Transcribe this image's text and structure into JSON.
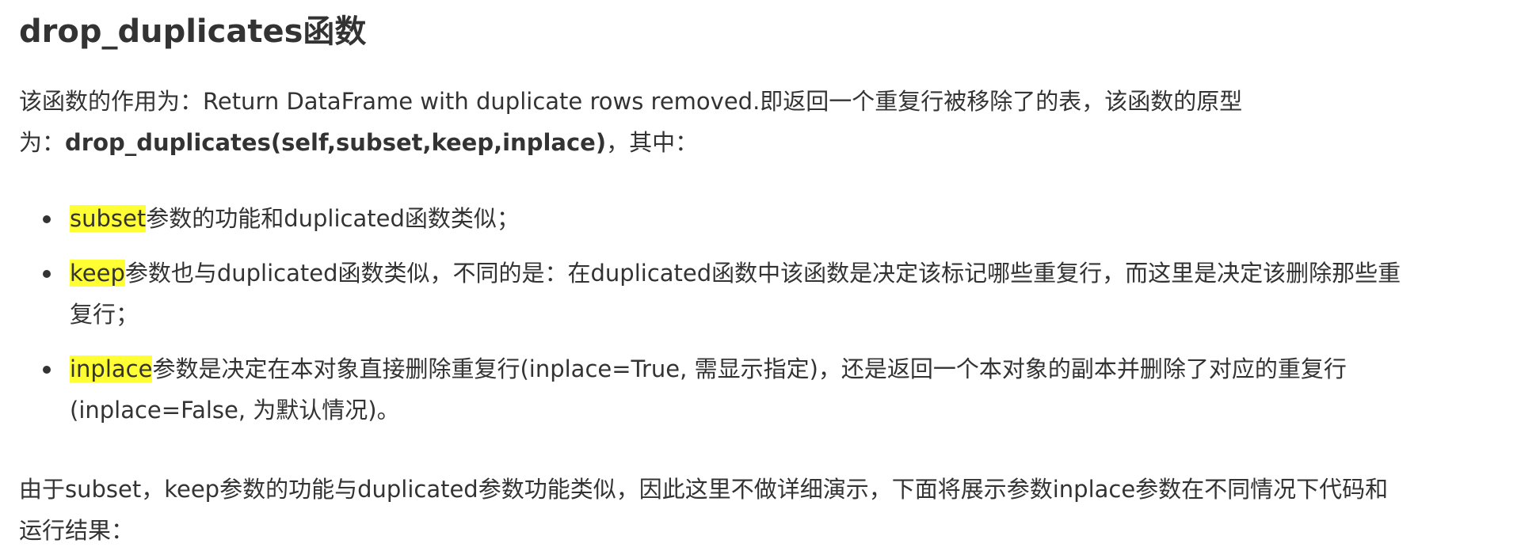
{
  "heading": "drop_duplicates函数",
  "intro": {
    "line1": "该函数的作用为：Return DataFrame with duplicate rows removed.即返回一个重复行被移除了的表，该函数的原型",
    "line2_prefix": "为：",
    "signature": "drop_duplicates(self,subset,keep,inplace)",
    "line2_suffix": "，其中："
  },
  "params": [
    {
      "name": "subset",
      "line1": "参数的功能和duplicated函数类似；",
      "line2": ""
    },
    {
      "name": "keep",
      "line1": "参数也与duplicated函数类似，不同的是：在duplicated函数中该函数是决定该标记哪些重复行，而这里是决定该删除那些重",
      "line2": "复行；"
    },
    {
      "name": "inplace",
      "line1": "参数是决定在本对象直接删除重复行(inplace=True, 需显示指定)，还是返回一个本对象的副本并删除了对应的重复行",
      "line2": "(inplace=False, 为默认情况)。"
    }
  ],
  "closing": {
    "line1": "由于subset，keep参数的功能与duplicated参数功能类似，因此这里不做详细演示，下面将展示参数inplace参数在不同情况下代码和",
    "line2": "运行结果："
  },
  "colors": {
    "text": "#333333",
    "highlight": "#ffff33",
    "background": "#ffffff"
  }
}
